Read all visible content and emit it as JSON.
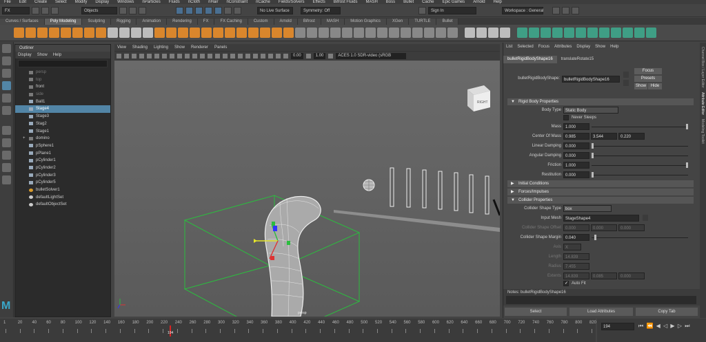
{
  "menubar": {
    "items": [
      "File",
      "Edit",
      "Create",
      "Select",
      "Modify",
      "Display",
      "Windows",
      "nParticles",
      "Fluids",
      "nCloth",
      "nHair",
      "nConstraint",
      "nCache",
      "Fields/Solvers",
      "Effects",
      "Bifrost Fluids",
      "MASH",
      "Boss",
      "Bullet",
      "Cache",
      "Epic Games",
      "Arnold",
      "Help"
    ],
    "workspace_label": "Workspace : General"
  },
  "status": {
    "mode": "FX",
    "select_mode": "Objects",
    "live_surface": "No Live Surface",
    "symmetry": "Symmetry: Off",
    "sign_in": "Sign In"
  },
  "shelf_tabs": [
    "Curves / Surfaces",
    "Poly Modeling",
    "Sculpting",
    "Rigging",
    "Animation",
    "Rendering",
    "FX",
    "FX Caching",
    "Custom",
    "Arnold",
    "Bifrost",
    "MASH",
    "Motion Graphics",
    "XGen",
    "TURTLE",
    "Bullet"
  ],
  "shelf_active": "Poly Modeling",
  "outliner": {
    "title": "Outliner",
    "menus": [
      "Display",
      "Show",
      "Help"
    ],
    "items": [
      {
        "label": "persp",
        "dim": true,
        "icon": "camera"
      },
      {
        "label": "top",
        "dim": true,
        "icon": "camera"
      },
      {
        "label": "front",
        "dim": false,
        "icon": "camera"
      },
      {
        "label": "side",
        "dim": true,
        "icon": "camera"
      },
      {
        "label": "Ball1",
        "dim": false,
        "icon": "mesh"
      },
      {
        "label": "Stage4",
        "dim": false,
        "icon": "mesh",
        "selected": true
      },
      {
        "label": "Stage3",
        "dim": false,
        "icon": "mesh"
      },
      {
        "label": "Stag2",
        "dim": false,
        "icon": "mesh"
      },
      {
        "label": "Stage1",
        "dim": false,
        "icon": "mesh"
      },
      {
        "label": "domino",
        "dim": false,
        "icon": "group",
        "expand": "+"
      },
      {
        "label": "pSphere1",
        "dim": false,
        "icon": "mesh"
      },
      {
        "label": "pPlane1",
        "dim": false,
        "icon": "mesh"
      },
      {
        "label": "pCylinder1",
        "dim": false,
        "icon": "mesh"
      },
      {
        "label": "pCylinder2",
        "dim": false,
        "icon": "mesh"
      },
      {
        "label": "pCylinder3",
        "dim": false,
        "icon": "mesh"
      },
      {
        "label": "pCylinder5",
        "dim": false,
        "icon": "mesh"
      },
      {
        "label": "bulletSolver1",
        "dim": false,
        "icon": "solver"
      },
      {
        "label": "defaultLightSet",
        "dim": false,
        "icon": "set"
      },
      {
        "label": "defaultObjectSet",
        "dim": false,
        "icon": "set"
      }
    ]
  },
  "viewport": {
    "menus": [
      "View",
      "Shading",
      "Lighting",
      "Show",
      "Renderer",
      "Panels"
    ],
    "value1": "0.00",
    "value2": "1.00",
    "colorspace": "ACES 1.0 SDR-video (sRGB",
    "viewcube_label": "RIGHT",
    "camera_label": "persp"
  },
  "attr": {
    "menus": [
      "List",
      "Selected",
      "Focus",
      "Attributes",
      "Display",
      "Show",
      "Help"
    ],
    "tabs": [
      "bulletRigidBodyShape16",
      "translateRotate15"
    ],
    "node_label": "bulletRigidBodyShape:",
    "node_value": "bulletRigidBodyShape16",
    "focus": "Focus",
    "presets": "Presets",
    "show": "Show",
    "hide": "Hide",
    "sections": {
      "rigid": "Rigid Body Properties",
      "initial": "Initial Conditions",
      "forces": "Forces/Impulses",
      "collider": "Collider Properties"
    },
    "body_type_label": "Body Type",
    "body_type": "Static Body",
    "never_sleeps": "Never Sleeps",
    "mass_label": "Mass",
    "mass": "1.000",
    "mass_level": 1.0,
    "com_label": "Center Of Mass",
    "com": [
      "0.985",
      "3.544",
      "0.220"
    ],
    "lin_damp_label": "Linear Damping",
    "lin_damp": "0.000",
    "ang_damp_label": "Angular Damping",
    "ang_damp": "0.000",
    "friction_label": "Friction",
    "friction": "1.000",
    "friction_level": 1.0,
    "restitution_label": "Restitution",
    "restitution": "0.000",
    "shape_type_label": "Collider Shape Type",
    "shape_type": "box",
    "input_mesh_label": "Input Mesh",
    "input_mesh": "StageShape4",
    "offset_label": "Collider Shape Offset",
    "offset": [
      "0.000",
      "0.000",
      "0.000"
    ],
    "margin_label": "Collider Shape Margin",
    "margin": "0.040",
    "axis_label": "Axis",
    "axis": "X",
    "length_label": "Length",
    "length": "14.839",
    "radius_label": "Radius",
    "radius": "7.455",
    "extents_label": "Extents",
    "extents": [
      "14.839",
      "0.085",
      "0.000"
    ],
    "auto_fit": "Auto Fit",
    "notes": "Notes: bulletRigidBodyShape16",
    "select_btn": "Select",
    "load_btn": "Load Attributes",
    "copy_btn": "Copy Tab"
  },
  "side_tabs": [
    "Channel Box / Layer Editor",
    "Attribute Editor",
    "Modeling Toolkit"
  ],
  "timeline": {
    "ticks": [
      "1",
      "20",
      "40",
      "60",
      "80",
      "100",
      "120",
      "140",
      "160",
      "180",
      "200",
      "220",
      "240",
      "260",
      "280",
      "300",
      "320",
      "340",
      "360",
      "380",
      "400",
      "420",
      "440",
      "460",
      "480",
      "500",
      "520",
      "540",
      "560",
      "580",
      "600",
      "620",
      "640",
      "660",
      "680",
      "700",
      "720",
      "740",
      "760",
      "780",
      "800",
      "820"
    ],
    "current_marker": "194",
    "current_frame": "194"
  },
  "colors": {
    "accent_orange": "#d9862c",
    "selection_blue": "#5285a6",
    "wire_green": "#2bbd3e"
  }
}
